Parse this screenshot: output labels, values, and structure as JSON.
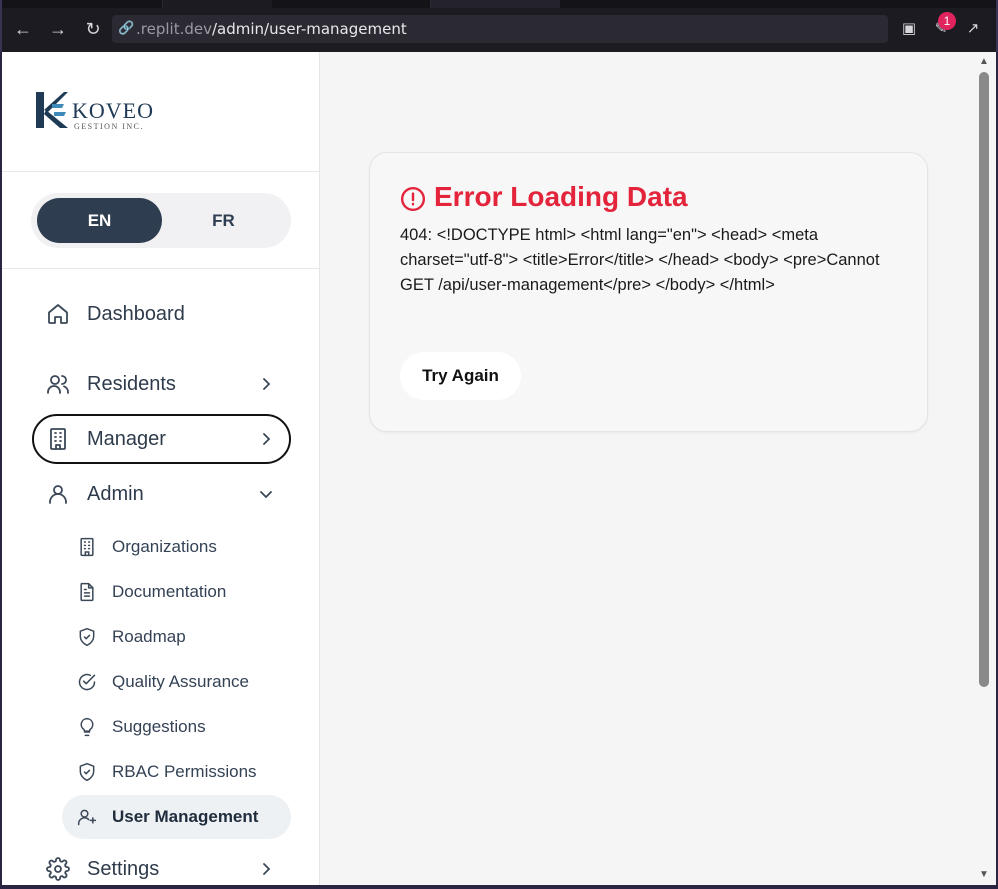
{
  "browser": {
    "url_host": ".replit.dev",
    "url_path": "/admin/user-management",
    "extensions_badge": "1"
  },
  "sidebar": {
    "logo_name": "KOVEO",
    "logo_sub": "GESTION INC.",
    "lang": {
      "en": "EN",
      "fr": "FR",
      "active": "EN"
    },
    "nav": [
      {
        "label": "Dashboard",
        "icon": "home-icon"
      },
      {
        "label": "Residents",
        "icon": "users-icon"
      },
      {
        "label": "Manager",
        "icon": "building-icon"
      },
      {
        "label": "Admin",
        "icon": "user-icon"
      }
    ],
    "admin_items": [
      {
        "label": "Organizations",
        "icon": "building-icon"
      },
      {
        "label": "Documentation",
        "icon": "file-text-icon"
      },
      {
        "label": "Roadmap",
        "icon": "shield-icon"
      },
      {
        "label": "Quality Assurance",
        "icon": "check-circle-icon"
      },
      {
        "label": "Suggestions",
        "icon": "lightbulb-icon"
      },
      {
        "label": "RBAC Permissions",
        "icon": "shield-icon"
      },
      {
        "label": "User Management",
        "icon": "user-plus-icon"
      }
    ],
    "settings": {
      "label": "Settings",
      "icon": "gear-icon"
    }
  },
  "error_card": {
    "title": "Error Loading Data",
    "message": "404: <!DOCTYPE html> <html lang=\"en\"> <head> <meta charset=\"utf-8\"> <title>Error</title> </head> <body> <pre>Cannot GET /api/user-management</pre> </body> </html>",
    "retry_label": "Try Again",
    "accent_color": "#e3243b"
  }
}
